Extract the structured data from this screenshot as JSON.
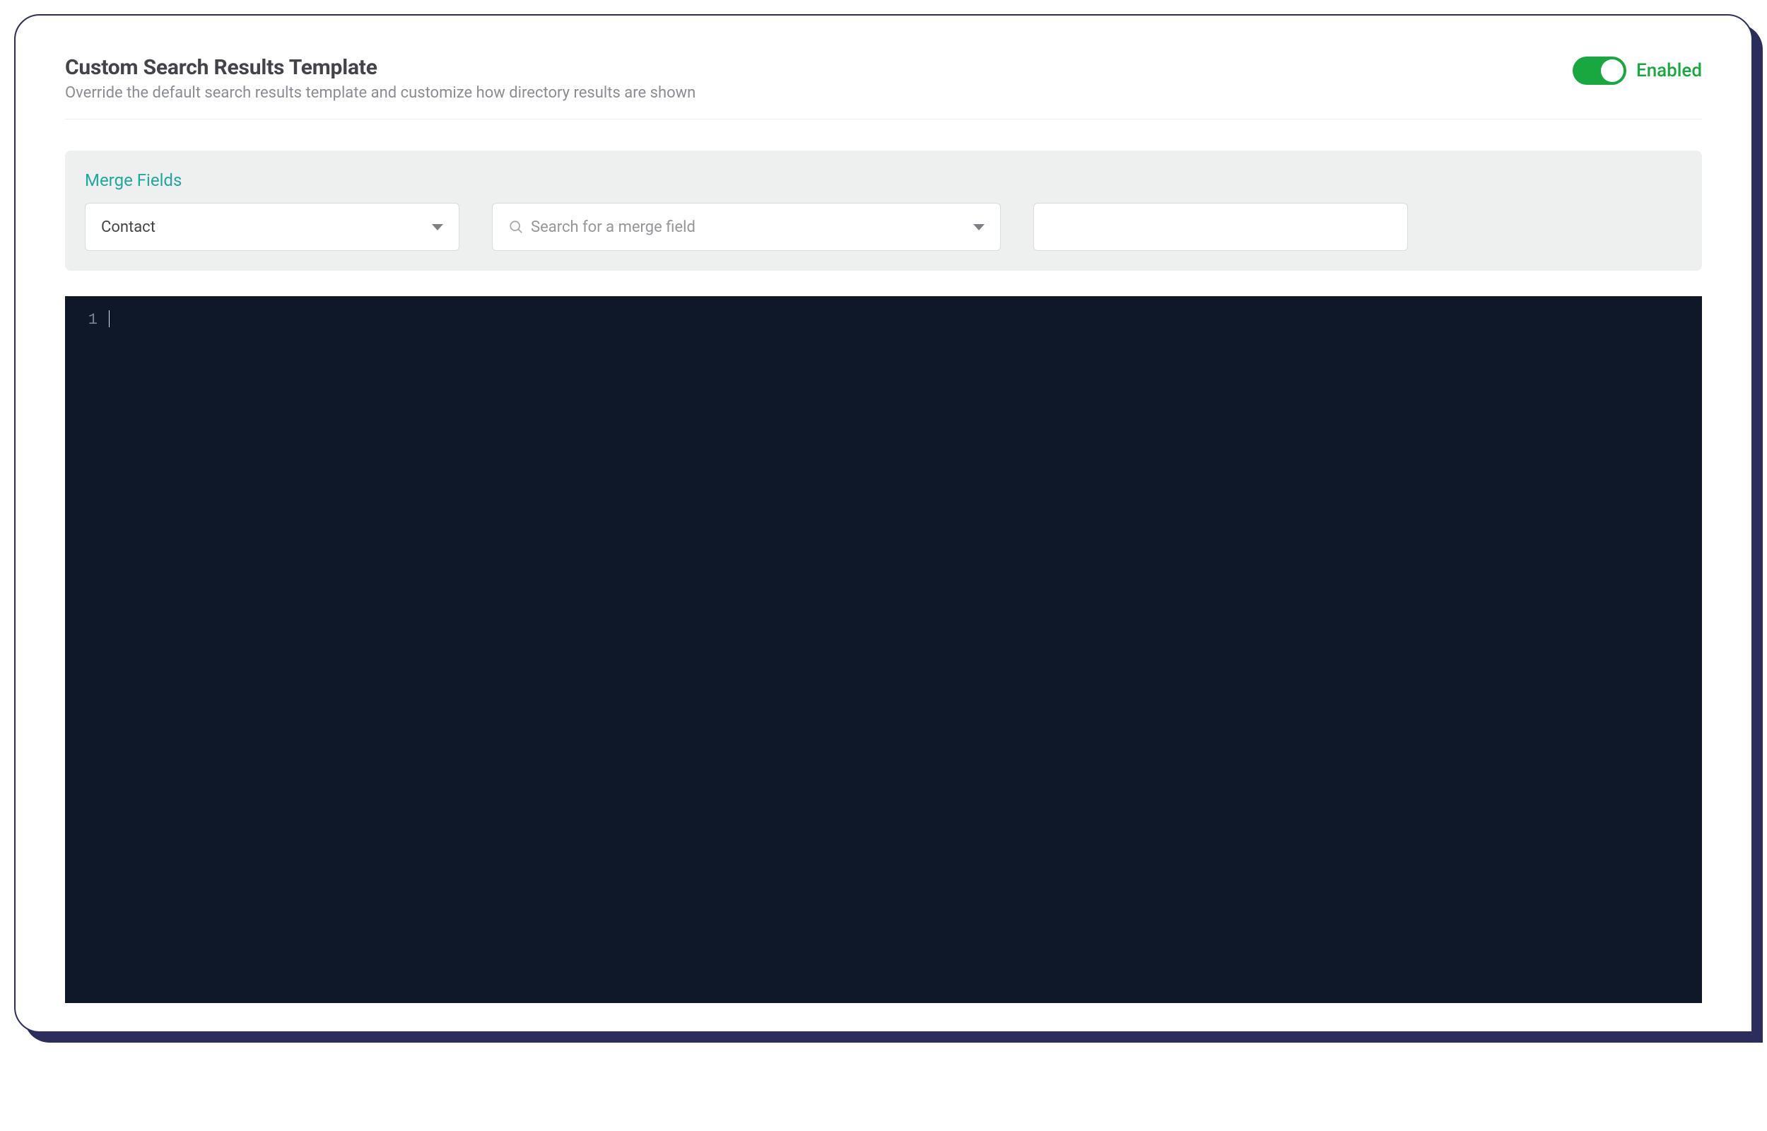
{
  "header": {
    "title": "Custom Search Results Template",
    "subtitle": "Override the default search results template and customize how directory results are shown"
  },
  "toggle": {
    "enabled": true,
    "label": "Enabled"
  },
  "merge_fields": {
    "section_label": "Merge Fields",
    "type_select": {
      "value": "Contact"
    },
    "search": {
      "placeholder": "Search for a merge field"
    },
    "output": {
      "value": ""
    }
  },
  "editor": {
    "lines": [
      "1"
    ],
    "content": ""
  }
}
